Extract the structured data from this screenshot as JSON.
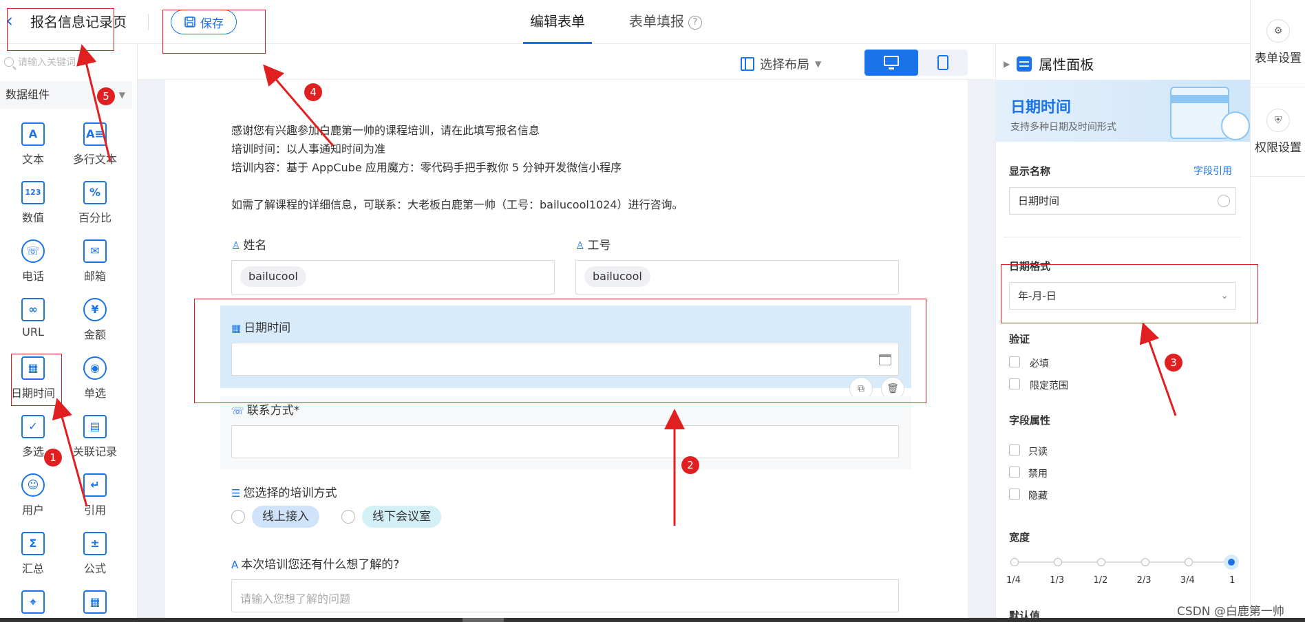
{
  "header": {
    "back_icon": "chevron-left-icon",
    "title": "报名信息记录页",
    "save_label": "保存",
    "tabs": [
      {
        "label": "编辑表单",
        "active": true
      },
      {
        "label": "表单填报",
        "active": false
      }
    ],
    "help_glyph": "?"
  },
  "right_rail": {
    "items": [
      {
        "label": "表单设置",
        "icon": "form-settings-icon"
      },
      {
        "label": "权限设置",
        "icon": "permission-shield-icon"
      }
    ]
  },
  "left_panel": {
    "search_placeholder": "请输入关键词",
    "group_label": "数据组件",
    "components": [
      {
        "label": "文本",
        "icon": "text-icon",
        "glyph": "A"
      },
      {
        "label": "多行文本",
        "icon": "multiline-text-icon",
        "glyph": "A≡"
      },
      {
        "label": "数值",
        "icon": "number-icon",
        "glyph": "123"
      },
      {
        "label": "百分比",
        "icon": "percent-icon",
        "glyph": "%"
      },
      {
        "label": "电话",
        "icon": "phone-icon",
        "glyph": "☏"
      },
      {
        "label": "邮箱",
        "icon": "email-icon",
        "glyph": "✉"
      },
      {
        "label": "URL",
        "icon": "link-icon",
        "glyph": "∞"
      },
      {
        "label": "金额",
        "icon": "currency-icon",
        "glyph": "¥"
      },
      {
        "label": "日期时间",
        "icon": "calendar-icon",
        "glyph": "▦"
      },
      {
        "label": "单选",
        "icon": "radio-icon",
        "glyph": "◉"
      },
      {
        "label": "多选",
        "icon": "checkbox-icon",
        "glyph": "✓"
      },
      {
        "label": "关联记录",
        "icon": "relation-icon",
        "glyph": "▤"
      },
      {
        "label": "用户",
        "icon": "user-icon",
        "glyph": "☺"
      },
      {
        "label": "引用",
        "icon": "reference-icon",
        "glyph": "↵"
      },
      {
        "label": "汇总",
        "icon": "sum-icon",
        "glyph": "Σ"
      },
      {
        "label": "公式",
        "icon": "formula-icon",
        "glyph": "±"
      },
      {
        "label": "",
        "icon": "location-icon",
        "glyph": "⌖"
      },
      {
        "label": "",
        "icon": "schedule-icon",
        "glyph": "▦"
      }
    ]
  },
  "canvas_toolbar": {
    "layout_label": "选择布局",
    "view_mode": "desktop"
  },
  "form": {
    "intro": "感谢您有兴趣参加白鹿第一帅的课程培训，请在此填写报名信息\n培训时间：以人事通知时间为准\n培训内容：基于 AppCube 应用魔方：零代码手把手教你 5 分钟开发微信小程序\n\n如需了解课程的详细信息，可联系：大老板白鹿第一帅（工号：bailucool1024）进行咨询。",
    "name_label": "姓名",
    "name_value": "bailucool",
    "id_label": "工号",
    "id_value": "bailucool",
    "datetime_label": "日期时间",
    "contact_label": "联系方式*",
    "training_label": "您选择的培训方式",
    "training_options": [
      "线上接入",
      "线下会议室"
    ],
    "question_label": "本次培训您还有什么想了解的?",
    "question_placeholder": "请输入您想了解的问题"
  },
  "property_panel": {
    "title": "属性面板",
    "banner_title": "日期时间",
    "banner_subtitle": "支持多种日期及时间形式",
    "display_name_label": "显示名称",
    "field_ref_link": "字段引用",
    "display_name_value": "日期时间",
    "date_format_label": "日期格式",
    "date_format_value": "年-月-日",
    "validation_label": "验证",
    "validation_options": [
      "必填",
      "限定范围"
    ],
    "field_props_label": "字段属性",
    "field_props_options": [
      "只读",
      "禁用",
      "隐藏"
    ],
    "width_label": "宽度",
    "width_ticks": [
      "1/4",
      "1/3",
      "1/2",
      "2/3",
      "3/4",
      "1"
    ],
    "width_value": "1",
    "default_label": "默认值"
  },
  "annotations": {
    "badges": [
      "1",
      "2",
      "3",
      "4",
      "5"
    ]
  },
  "watermark": "CSDN @白鹿第一帅",
  "colors": {
    "accent": "#1a73e8",
    "selected_bg": "#d8ebfb",
    "annotation_red": "#e02020"
  }
}
